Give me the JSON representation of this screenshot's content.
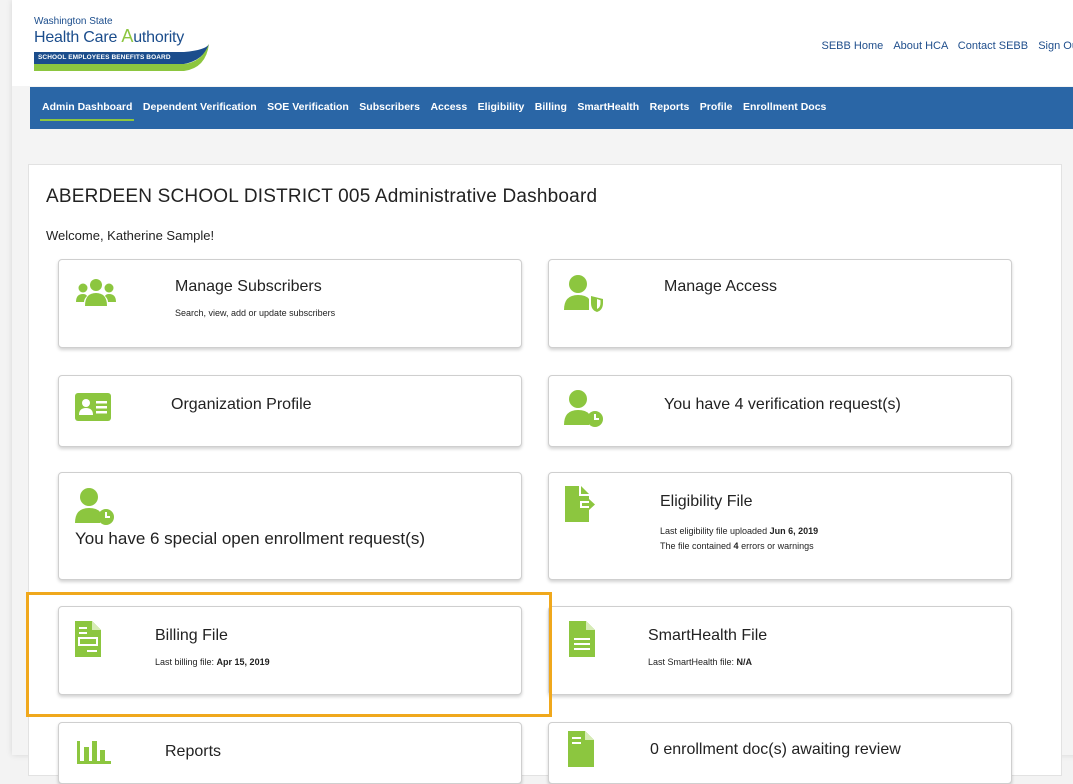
{
  "colors": {
    "brand_blue": "#2a66a6",
    "accent_green": "#8cc63f",
    "highlight": "#f0a81c"
  },
  "logo": {
    "line1": "Washington State",
    "line2_a": "Health Care ",
    "line2_b": "A",
    "line2_c": "uthority",
    "line3": "SCHOOL EMPLOYEES BENEFITS BOARD"
  },
  "top_links": [
    "SEBB Home",
    "About HCA",
    "Contact SEBB",
    "Sign Out"
  ],
  "nav": {
    "items": [
      "Admin Dashboard",
      "Dependent Verification",
      "SOE Verification",
      "Subscribers",
      "Access",
      "Eligibility",
      "Billing",
      "SmartHealth",
      "Reports",
      "Profile",
      "Enrollment Docs"
    ],
    "active": "Admin Dashboard"
  },
  "dashboard": {
    "title": "ABERDEEN SCHOOL DISTRICT 005 Administrative Dashboard",
    "welcome": "Welcome, Katherine Sample!"
  },
  "cards": {
    "manage_subscribers": {
      "title": "Manage Subscribers",
      "subtitle": "Search, view, add or update subscribers",
      "icon": "users-group-icon"
    },
    "manage_access": {
      "title": "Manage Access",
      "icon": "user-shield-icon"
    },
    "organization_profile": {
      "title": "Organization Profile",
      "icon": "id-card-icon"
    },
    "verification_requests": {
      "title": "You have 4 verification request(s)",
      "icon": "user-clock-icon"
    },
    "special_open_enrollment": {
      "title": "You have 6 special open enrollment request(s)",
      "icon": "user-clock-icon"
    },
    "eligibility_file": {
      "title": "Eligibility File",
      "line1_prefix": "Last eligibility file uploaded ",
      "line1_value": "Jun 6, 2019",
      "line2_prefix": "The file contained ",
      "line2_value": "4",
      "line2_suffix": " errors or warnings",
      "icon": "file-export-icon"
    },
    "billing_file": {
      "title": "Billing File",
      "line_prefix": "Last billing file: ",
      "line_value": "Apr 15, 2019",
      "icon": "file-invoice-icon"
    },
    "smarthealth_file": {
      "title": "SmartHealth File",
      "line_prefix": "Last SmartHealth file: ",
      "line_value": "N/A",
      "icon": "file-lines-icon"
    },
    "reports": {
      "title": "Reports",
      "icon": "bar-chart-icon"
    },
    "enrollment_docs": {
      "title": "0 enrollment doc(s) awaiting review",
      "icon": "file-lines-icon"
    }
  }
}
